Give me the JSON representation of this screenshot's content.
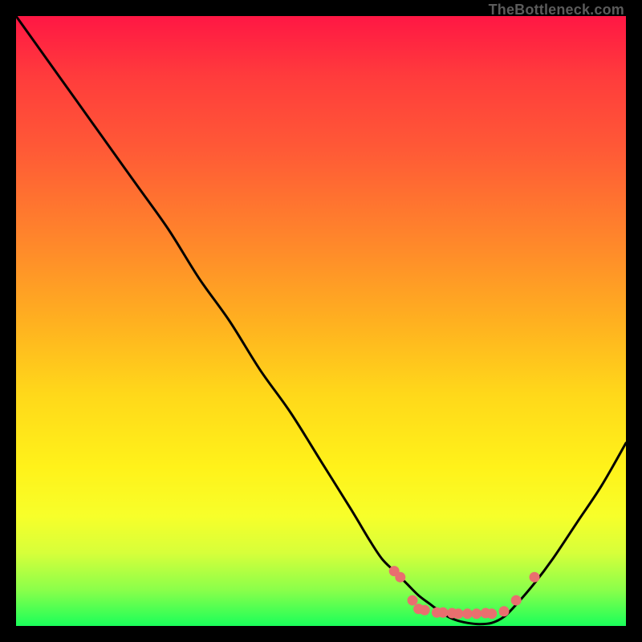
{
  "attribution": "TheBottleneck.com",
  "colors": {
    "background": "#000000",
    "curve": "#000000",
    "markers_fill": "#e96f6f",
    "markers_stroke": "#e96f6f",
    "gradient_top": "#ff1744",
    "gradient_mid": "#fff21a",
    "gradient_bottom": "#1aff5a"
  },
  "chart_data": {
    "type": "line",
    "title": "",
    "xlabel": "",
    "ylabel": "",
    "xlim": [
      0,
      100
    ],
    "ylim": [
      0,
      100
    ],
    "x": [
      0,
      5,
      10,
      15,
      20,
      25,
      30,
      35,
      40,
      45,
      50,
      55,
      58,
      60,
      62,
      64,
      66,
      68,
      70,
      72,
      74,
      76,
      78,
      80,
      82,
      85,
      88,
      92,
      96,
      100
    ],
    "values": [
      100,
      93,
      86,
      79,
      72,
      65,
      57,
      50,
      42,
      35,
      27,
      19,
      14,
      11,
      9,
      7,
      5,
      3.5,
      2,
      1,
      0.5,
      0.3,
      0.5,
      1.5,
      3.5,
      7,
      11,
      17,
      23,
      30
    ],
    "marker_points": [
      {
        "x": 62,
        "y": 9
      },
      {
        "x": 63,
        "y": 8
      },
      {
        "x": 65,
        "y": 4.2
      },
      {
        "x": 66,
        "y": 2.8
      },
      {
        "x": 67,
        "y": 2.6
      },
      {
        "x": 69,
        "y": 2.2
      },
      {
        "x": 70,
        "y": 2.2
      },
      {
        "x": 71.5,
        "y": 2.1
      },
      {
        "x": 72.5,
        "y": 2.0
      },
      {
        "x": 74,
        "y": 2.0
      },
      {
        "x": 75.5,
        "y": 2.0
      },
      {
        "x": 77,
        "y": 2.1
      },
      {
        "x": 78,
        "y": 2.0
      },
      {
        "x": 80,
        "y": 2.4
      },
      {
        "x": 82,
        "y": 4.2
      },
      {
        "x": 85,
        "y": 8
      }
    ]
  }
}
